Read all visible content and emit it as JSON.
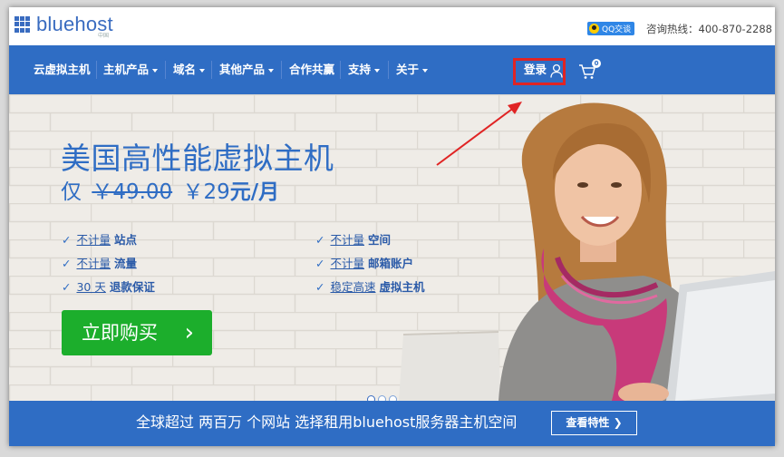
{
  "brand": {
    "logo_text": "bluehost",
    "logo_sub": "中国"
  },
  "header": {
    "qq_label": "QQ交谈",
    "hotline": "咨询热线：400-870-2288"
  },
  "nav": {
    "items": [
      {
        "label": "云虚拟主机",
        "dropdown": false
      },
      {
        "label": "主机产品",
        "dropdown": true
      },
      {
        "label": "域名",
        "dropdown": true
      },
      {
        "label": "其他产品",
        "dropdown": true
      },
      {
        "label": "合作共赢",
        "dropdown": false
      },
      {
        "label": "支持",
        "dropdown": true
      },
      {
        "label": "关于",
        "dropdown": true
      }
    ],
    "login_label": "登录",
    "cart_count": "0"
  },
  "hero": {
    "headline": "美国高性能虚拟主机",
    "price_prefix": "仅",
    "old_price": "￥49.00",
    "new_price": "￥29",
    "price_unit": "元/月",
    "features": [
      {
        "underlined": "不计量",
        "bold": "站点"
      },
      {
        "underlined": "不计量",
        "bold": "空间"
      },
      {
        "underlined": "不计量",
        "bold": "流量"
      },
      {
        "underlined": "不计量",
        "bold": "邮箱账户"
      },
      {
        "underlined": "30 天",
        "bold": "退款保证"
      },
      {
        "underlined": "稳定高速",
        "bold": "虚拟主机"
      }
    ],
    "buy_button": "立即购买",
    "slide_count": 3,
    "active_slide": 1
  },
  "banner": {
    "tagline": "全球超过 两百万 个网站 选择租用bluehost服务器主机空间",
    "features_button": "查看特性"
  },
  "colors": {
    "brand_blue": "#2f6dc4",
    "buy_green": "#1cae2c",
    "highlight_red": "#e02424"
  }
}
